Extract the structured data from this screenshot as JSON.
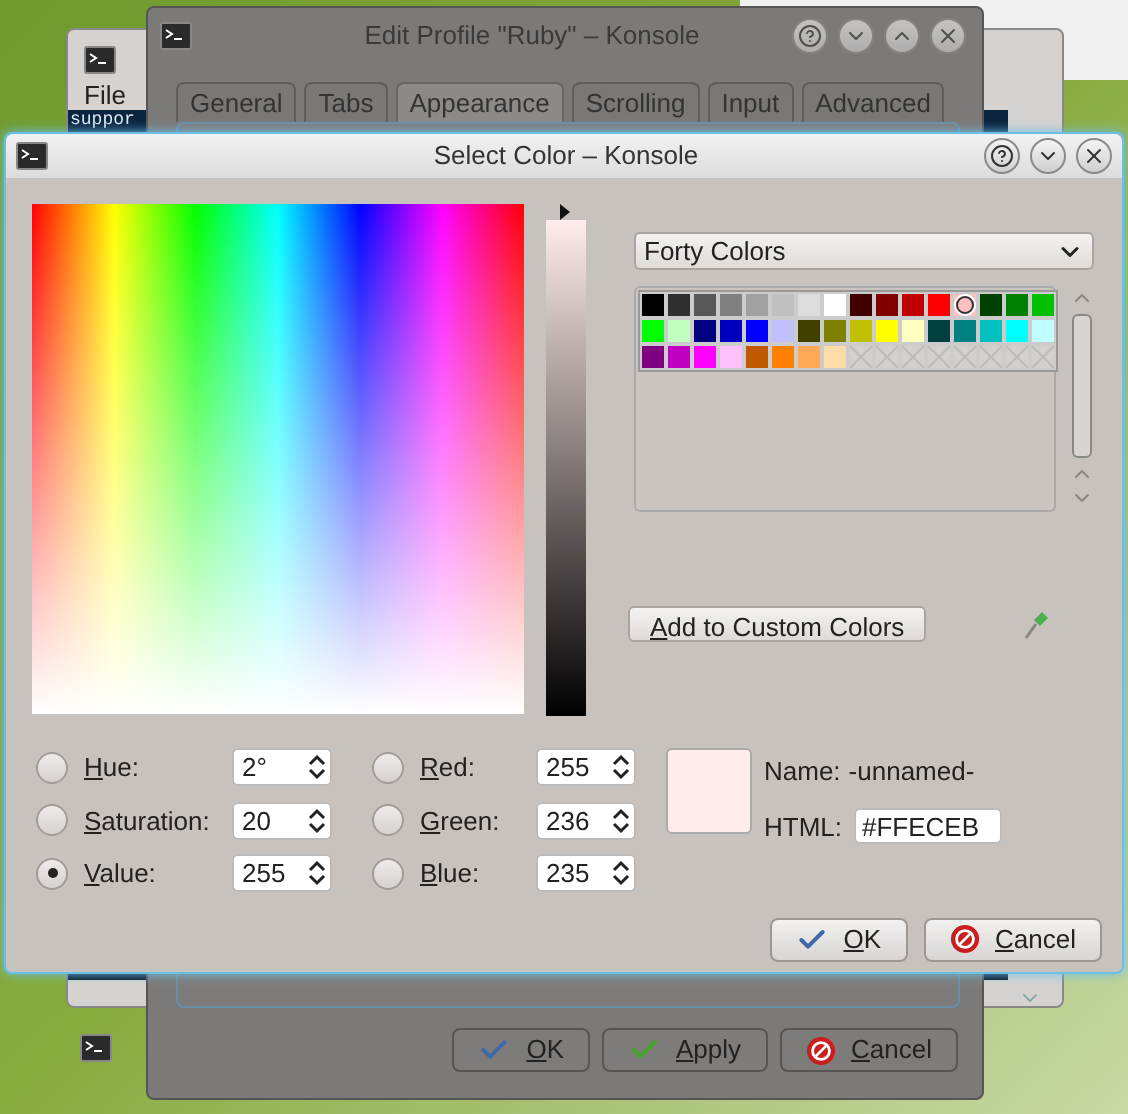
{
  "background_window": {
    "menu": [
      "File"
    ],
    "terminal_text": "suppor"
  },
  "profile_dialog": {
    "title": "Edit Profile \"Ruby\" – Konsole",
    "tabs": [
      {
        "label": "General",
        "selected": false
      },
      {
        "label": "Tabs",
        "selected": false
      },
      {
        "label": "Appearance",
        "selected": true
      },
      {
        "label": "Scrolling",
        "selected": false
      },
      {
        "label": "Input",
        "selected": false
      },
      {
        "label": "Advanced",
        "selected": false
      }
    ],
    "buttons": [
      {
        "label": "OK",
        "kind": "ok"
      },
      {
        "label": "Apply",
        "kind": "apply"
      },
      {
        "label": "Cancel",
        "kind": "cancel"
      }
    ]
  },
  "color_dialog": {
    "title": "Select Color – Konsole",
    "palette": "Forty Colors",
    "swatches": [
      {
        "kind": "color",
        "color": "#000000",
        "selected": false
      },
      {
        "kind": "color",
        "color": "#303030",
        "selected": false
      },
      {
        "kind": "color",
        "color": "#585858",
        "selected": false
      },
      {
        "kind": "color",
        "color": "#808080",
        "selected": false
      },
      {
        "kind": "color",
        "color": "#a0a0a0",
        "selected": false
      },
      {
        "kind": "color",
        "color": "#c0c0c0",
        "selected": false
      },
      {
        "kind": "color",
        "color": "#dcdcdc",
        "selected": false
      },
      {
        "kind": "color",
        "color": "#ffffff",
        "selected": false
      },
      {
        "kind": "color",
        "color": "#400000",
        "selected": false
      },
      {
        "kind": "color",
        "color": "#800000",
        "selected": false
      },
      {
        "kind": "color",
        "color": "#c00000",
        "selected": false
      },
      {
        "kind": "color",
        "color": "#ff0000",
        "selected": false
      },
      {
        "kind": "color",
        "color": "#ffc0c0",
        "selected": true
      },
      {
        "kind": "color",
        "color": "#004000",
        "selected": false
      },
      {
        "kind": "color",
        "color": "#008000",
        "selected": false
      },
      {
        "kind": "color",
        "color": "#00c000",
        "selected": false
      },
      {
        "kind": "color",
        "color": "#00ff00",
        "selected": false
      },
      {
        "kind": "color",
        "color": "#c0ffc0",
        "selected": false
      },
      {
        "kind": "color",
        "color": "#000080",
        "selected": false
      },
      {
        "kind": "color",
        "color": "#0000c0",
        "selected": false
      },
      {
        "kind": "color",
        "color": "#0000ff",
        "selected": false
      },
      {
        "kind": "color",
        "color": "#c0c0ff",
        "selected": false
      },
      {
        "kind": "color",
        "color": "#404000",
        "selected": false
      },
      {
        "kind": "color",
        "color": "#808000",
        "selected": false
      },
      {
        "kind": "color",
        "color": "#c0c000",
        "selected": false
      },
      {
        "kind": "color",
        "color": "#ffff00",
        "selected": false
      },
      {
        "kind": "color",
        "color": "#ffffc0",
        "selected": false
      },
      {
        "kind": "color",
        "color": "#004040",
        "selected": false
      },
      {
        "kind": "color",
        "color": "#008080",
        "selected": false
      },
      {
        "kind": "color",
        "color": "#00c0c0",
        "selected": false
      },
      {
        "kind": "color",
        "color": "#00ffff",
        "selected": false
      },
      {
        "kind": "color",
        "color": "#c0ffff",
        "selected": false
      },
      {
        "kind": "color",
        "color": "#800080",
        "selected": false
      },
      {
        "kind": "color",
        "color": "#c000c0",
        "selected": false
      },
      {
        "kind": "color",
        "color": "#ff00ff",
        "selected": false
      },
      {
        "kind": "color",
        "color": "#ffc0ff",
        "selected": false
      },
      {
        "kind": "color",
        "color": "#c05800",
        "selected": false
      },
      {
        "kind": "color",
        "color": "#ff8000",
        "selected": false
      },
      {
        "kind": "color",
        "color": "#ffa858",
        "selected": false
      },
      {
        "kind": "color",
        "color": "#ffdca8",
        "selected": false
      },
      {
        "kind": "empty"
      },
      {
        "kind": "empty"
      },
      {
        "kind": "empty"
      },
      {
        "kind": "empty"
      },
      {
        "kind": "empty"
      },
      {
        "kind": "empty"
      },
      {
        "kind": "empty"
      },
      {
        "kind": "empty"
      }
    ],
    "value_slider": {
      "level": 1
    },
    "add_button": "Add to Custom Colors",
    "hsv": [
      {
        "label": "Hue:",
        "value": "2°",
        "selected": false
      },
      {
        "label": "Saturation:",
        "value": "20",
        "selected": false
      },
      {
        "label": "Value:",
        "value": "255",
        "selected": true
      }
    ],
    "rgb": [
      {
        "label": "Red:",
        "value": "255",
        "selected": false
      },
      {
        "label": "Green:",
        "value": "236",
        "selected": false
      },
      {
        "label": "Blue:",
        "value": "235",
        "selected": false
      }
    ],
    "name_label": "Name:",
    "name_value": "-unnamed-",
    "html_label": "HTML:",
    "html_value": "#FFECEB",
    "buttons": [
      {
        "label": "OK",
        "kind": "ok"
      },
      {
        "label": "Cancel",
        "kind": "cancel"
      }
    ]
  }
}
